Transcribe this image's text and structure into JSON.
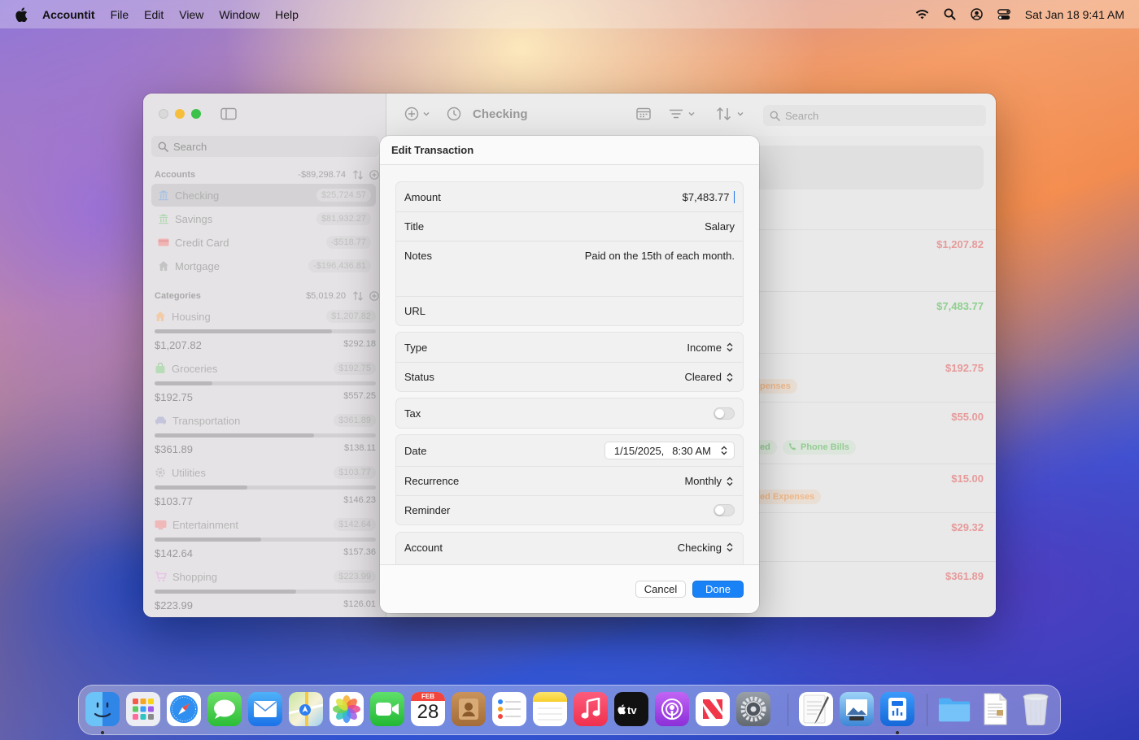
{
  "menubar": {
    "app_name": "Accountit",
    "menus": [
      "File",
      "Edit",
      "View",
      "Window",
      "Help"
    ],
    "clock": "Sat Jan 18  9:41 AM"
  },
  "sidebar": {
    "search_placeholder": "Search",
    "accounts_header": "Accounts",
    "accounts_total": "-$89,298.74",
    "accounts": [
      {
        "name": "Checking",
        "value": "$25,724.57",
        "icon": "bank-icon",
        "selected": true
      },
      {
        "name": "Savings",
        "value": "$81,932.27",
        "icon": "bank-icon"
      },
      {
        "name": "Credit Card",
        "value": "-$518.77",
        "icon": "credit-card-icon"
      },
      {
        "name": "Mortgage",
        "value": "-$196,436.81",
        "icon": "house-icon"
      }
    ],
    "categories_header": "Categories",
    "categories_total": "$5,019.20",
    "categories": [
      {
        "name": "Housing",
        "value": "$1,207.82",
        "spent": "$1,207.82",
        "remaining": "$292.18",
        "progress": 0.8,
        "icon": "house-icon"
      },
      {
        "name": "Groceries",
        "value": "$192.75",
        "spent": "$192.75",
        "remaining": "$557.25",
        "progress": 0.26,
        "icon": "bag-icon"
      },
      {
        "name": "Transportation",
        "value": "$361.89",
        "spent": "$361.89",
        "remaining": "$138.11",
        "progress": 0.72,
        "icon": "car-icon"
      },
      {
        "name": "Utilities",
        "value": "$103.77",
        "spent": "$103.77",
        "remaining": "$146.23",
        "progress": 0.42,
        "icon": "gear-icon"
      },
      {
        "name": "Entertainment",
        "value": "$142.64",
        "spent": "$142.64",
        "remaining": "$157.36",
        "progress": 0.48,
        "icon": "tv-icon"
      },
      {
        "name": "Shopping",
        "value": "$223.99",
        "spent": "$223.99",
        "remaining": "$126.01",
        "progress": 0.64,
        "icon": "cart-icon"
      }
    ]
  },
  "toolbar": {
    "title": "Checking",
    "search_placeholder": "Search"
  },
  "transactions": [
    {
      "amount": "$1,207.82",
      "kind": "neg"
    },
    {
      "amount": "$7,483.77",
      "kind": "pos"
    },
    {
      "amount": "$192.75",
      "kind": "neg",
      "tag": "penses"
    },
    {
      "amount": "$55.00",
      "kind": "neg",
      "tag": "ed",
      "tag2": "Phone Bills"
    },
    {
      "amount": "$15.00",
      "kind": "neg",
      "tag": "ed Expenses"
    },
    {
      "amount": "$29.32",
      "kind": "neg"
    },
    {
      "amount": "$361.89",
      "kind": "neg"
    }
  ],
  "dialog": {
    "title": "Edit Transaction",
    "amount_label": "Amount",
    "amount_value": "$7,483.77",
    "title_label": "Title",
    "title_value": "Salary",
    "notes_label": "Notes",
    "notes_value": "Paid on the 15th of each month.",
    "url_label": "URL",
    "type_label": "Type",
    "type_value": "Income",
    "status_label": "Status",
    "status_value": "Cleared",
    "tax_label": "Tax",
    "tax_on": false,
    "date_label": "Date",
    "date_value": "1/15/2025,",
    "time_value": "8:30 AM",
    "recurrence_label": "Recurrence",
    "recurrence_value": "Monthly",
    "reminder_label": "Reminder",
    "reminder_on": false,
    "account_label": "Account",
    "account_value": "Checking",
    "cancel_label": "Cancel",
    "done_label": "Done"
  },
  "dock": {
    "calendar_month": "FEB",
    "calendar_day": "28",
    "apps": [
      "finder-icon",
      "launchpad-icon",
      "safari-icon",
      "messages-icon",
      "mail-icon",
      "maps-icon",
      "photos-icon",
      "facetime-icon",
      "calendar-icon",
      "contacts-icon",
      "reminders-icon",
      "notes-icon",
      "music-icon",
      "appletv-icon",
      "podcasts-icon",
      "news-icon",
      "system-settings-icon",
      "textedit-icon",
      "preview-icon",
      "accountit-icon",
      "folder-icon",
      "document-icon",
      "trash-icon"
    ]
  },
  "colors": {
    "accent": "#1a82f7",
    "negative": "#e79a9a",
    "positive": "#8fcf8f"
  }
}
